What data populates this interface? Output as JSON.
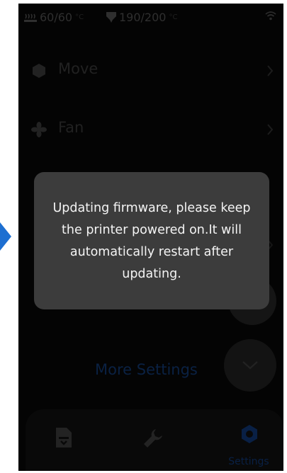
{
  "status_bar": {
    "bed_temp": "60/60",
    "bed_unit": "°C",
    "nozzle_temp": "190/200",
    "nozzle_unit": "°C",
    "bed_icon": "heated-bed-icon",
    "nozzle_icon": "nozzle-icon",
    "wifi_icon": "wifi-icon"
  },
  "menu": [
    {
      "label": "Move",
      "icon": "move-icon"
    },
    {
      "label": "Fan",
      "icon": "fan-icon"
    }
  ],
  "more_settings_label": "More Settings",
  "bottom_nav": {
    "tabs": [
      {
        "icon": "print-file-icon",
        "label": ""
      },
      {
        "icon": "wrench-icon",
        "label": ""
      },
      {
        "icon": "gear-icon",
        "label": "Settings"
      }
    ]
  },
  "dialog": {
    "message": "Updating firmware, please keep the printer powered on.It will automatically restart after updating."
  },
  "colors": {
    "screen_bg": "#060606",
    "dialog_bg": "#3c3c3c",
    "accent_blue": "#1d6fd1",
    "active_tab": "#0c2b5c"
  }
}
